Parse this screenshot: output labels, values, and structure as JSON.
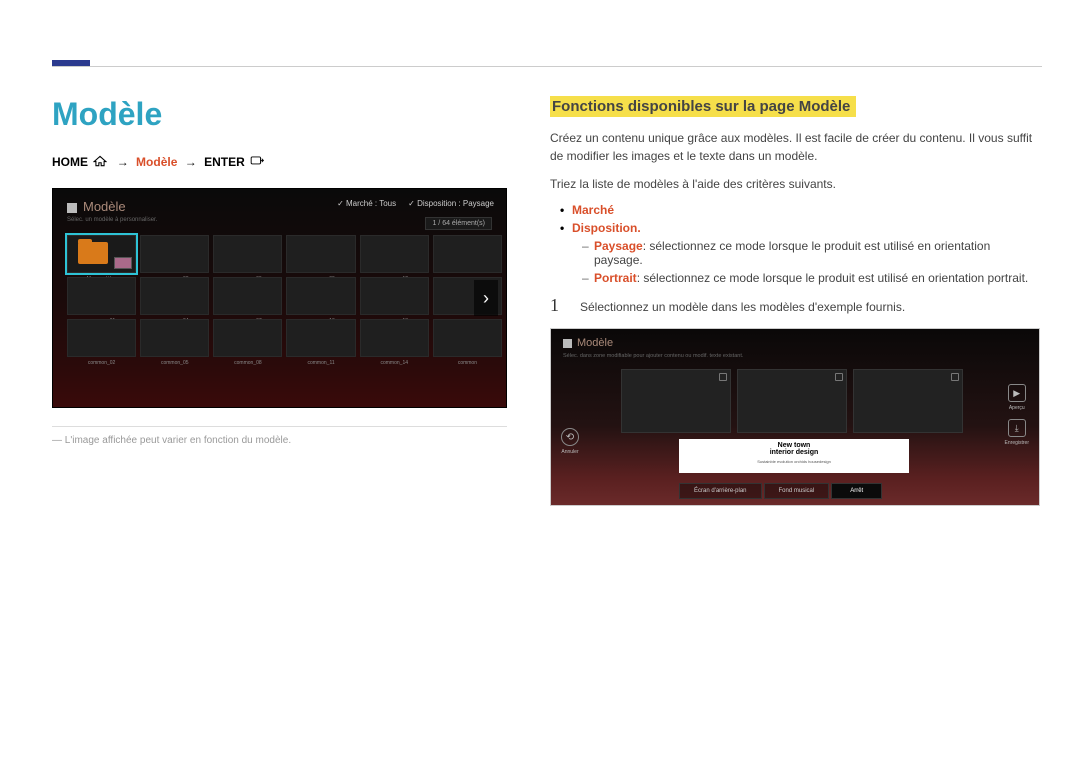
{
  "page": {
    "title": "Modèle",
    "breadcrumb": {
      "home": "HOME",
      "mid": "Modèle",
      "enter": "ENTER",
      "arrow": "→"
    },
    "footnote": "L'image affichée peut varier en fonction du modèle."
  },
  "section": {
    "heading": "Fonctions disponibles sur la page Modèle",
    "intro": "Créez un contenu unique grâce aux modèles. Il est facile de créer du contenu. Il vous suffit de modifier les images et le texte dans un modèle.",
    "sort_intro": "Triez la liste de modèles à l'aide des critères suivants.",
    "opt1": "Marché",
    "opt2": "Disposition.",
    "sub1_term": "Paysage",
    "sub1_desc": ": sélectionnez ce mode lorsque le produit est utilisé en orientation paysage.",
    "sub2_term": "Portrait",
    "sub2_desc": ": sélectionnez ce mode lorsque le produit est utilisé en orientation portrait.",
    "step_num": "1",
    "step_text": "Sélectionnez un modèle dans les modèles d'exemple fournis."
  },
  "thumb": {
    "title": "Modèle",
    "sub": "Sélec. un modèle à personnaliser.",
    "filter1": "Marché : Tous",
    "filter2": "Disposition : Paysage",
    "count": "1 / 64 élément(s)",
    "cells": [
      {
        "label": "Mes modèles"
      },
      {
        "label": "common_03"
      },
      {
        "label": "common_06"
      },
      {
        "label": "common_09"
      },
      {
        "label": "common_12"
      },
      {
        "label": "common"
      },
      {
        "label": "common_01"
      },
      {
        "label": "common_04"
      },
      {
        "label": "common_07"
      },
      {
        "label": "common_10"
      },
      {
        "label": "common_13"
      },
      {
        "label": "common"
      },
      {
        "label": "common_02"
      },
      {
        "label": "common_05"
      },
      {
        "label": "common_08"
      },
      {
        "label": "common_11"
      },
      {
        "label": "common_14"
      },
      {
        "label": "common"
      }
    ]
  },
  "editor": {
    "title": "Modèle",
    "sub": "Sélec. dans zone modifiable pour ajouter contenu ou modif. texte existant.",
    "text_l1": "New town",
    "text_l2": "interior design",
    "text_l3": "Sustainble evolution orchids housedesign",
    "left_btn": "Annuler",
    "right_btn1": "Aperçu",
    "right_btn2": "Enregistrer",
    "bot1": "Écran d'arrière-plan",
    "bot2": "Fond musical",
    "bot3": "Arrêt"
  }
}
